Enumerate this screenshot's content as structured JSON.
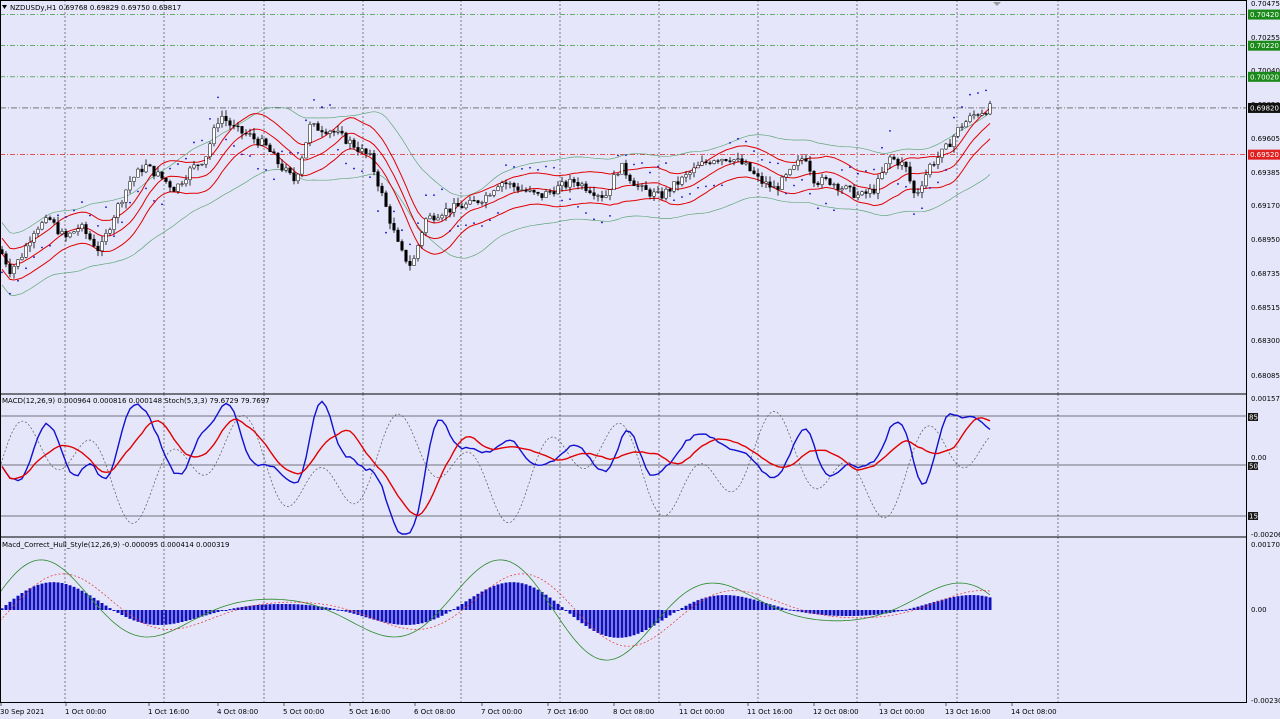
{
  "main": {
    "symbol_label": "NZDUSDy,H1  0.69768 0.69829 0.69750 0.69817",
    "price_ticks": [
      "0.70475",
      "0.70255",
      "0.70040",
      "0.69820",
      "0.69605",
      "0.69385",
      "0.69170",
      "0.68950",
      "0.68735",
      "0.68515",
      "0.68300",
      "0.68085"
    ],
    "levels": [
      {
        "label": "0.70420",
        "value": 0.7042,
        "color": "#1a8a1a"
      },
      {
        "label": "0.70220",
        "value": 0.7022,
        "color": "#1a8a1a"
      },
      {
        "label": "0.70020",
        "value": 0.7002,
        "color": "#1a8a1a"
      },
      {
        "label": "0.69820",
        "value": 0.6982,
        "color": "#000000"
      },
      {
        "label": "0.69520",
        "value": 0.6952,
        "color": "#e02020"
      }
    ]
  },
  "macd_panel": {
    "label": "MACD(12,26,9) 0.000964 0.000816 0.000148  Stoch(5,3,3) 79.6729 79.7697",
    "ticks": [
      "0.001573",
      "0.00",
      "-0.00206"
    ],
    "stoch_levels": [
      "85",
      "50",
      "15"
    ]
  },
  "hull_panel": {
    "label": "Macd_Correct_Hull_Style(12,26,9) -0.000095 0.000414 0.000319",
    "ticks": [
      "0.001709",
      "0.00",
      "-0.00230"
    ]
  },
  "time_axis": [
    "30 Sep 2021",
    "1 Oct 00:00",
    "1 Oct 16:00",
    "4 Oct 08:00",
    "5 Oct 00:00",
    "5 Oct 16:00",
    "6 Oct 08:00",
    "7 Oct 00:00",
    "7 Oct 16:00",
    "8 Oct 08:00",
    "11 Oct 00:00",
    "11 Oct 16:00",
    "12 Oct 08:00",
    "13 Oct 00:00",
    "13 Oct 16:00",
    "14 Oct 08:00"
  ],
  "colors": {
    "background": "#e6e6fa",
    "bull_candle": "#ffffff",
    "bear_candle": "#000000",
    "envelope": "#e00000",
    "bollinger": "#5fa87a",
    "sar": "#1010d0",
    "macd_main": "#1010d0",
    "macd_signal": "#e00000",
    "histogram": "#1010c0"
  }
}
